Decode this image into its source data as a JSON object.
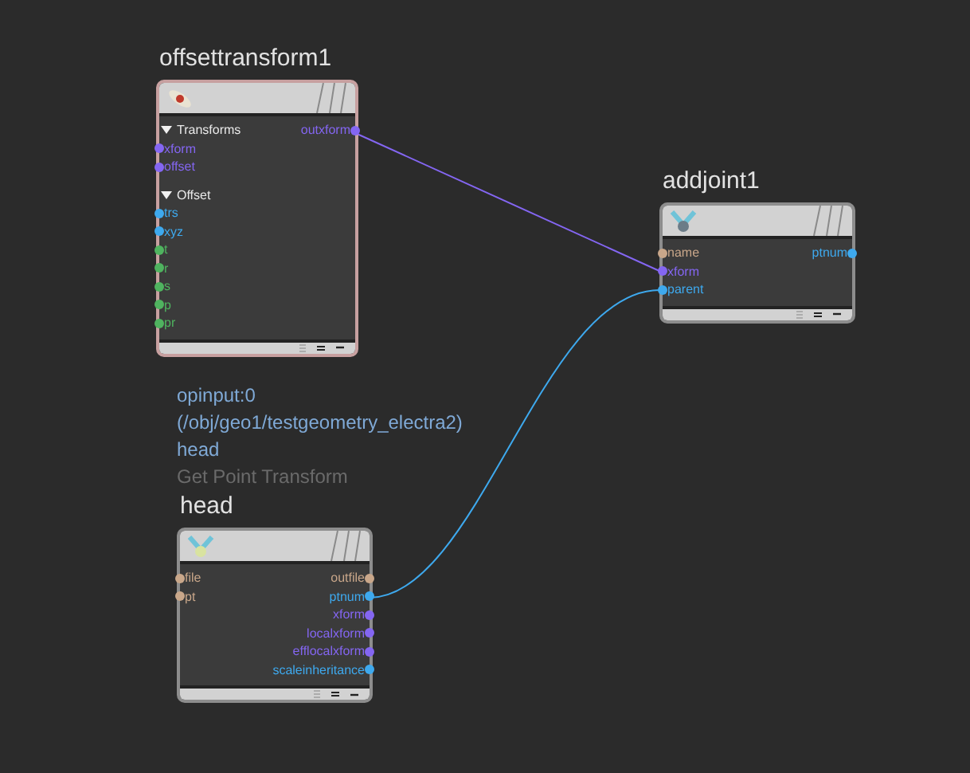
{
  "nodes": [
    {
      "name": "offsettransform1",
      "selected": true,
      "inputs": [
        {
          "kind": "group",
          "label": "Transforms",
          "expanded": true
        },
        {
          "kind": "port",
          "label": "xform",
          "color": "#8466f2"
        },
        {
          "kind": "port",
          "label": "offset",
          "color": "#8466f2"
        },
        {
          "kind": "group",
          "label": "Offset",
          "expanded": true
        },
        {
          "kind": "port",
          "label": "trs",
          "color": "#3ea9ee"
        },
        {
          "kind": "port",
          "label": "xyz",
          "color": "#3ea9ee"
        },
        {
          "kind": "port",
          "label": "t",
          "color": "#4fb35f"
        },
        {
          "kind": "port",
          "label": "r",
          "color": "#4fb35f"
        },
        {
          "kind": "port",
          "label": "s",
          "color": "#4fb35f"
        },
        {
          "kind": "port",
          "label": "p",
          "color": "#4fb35f"
        },
        {
          "kind": "port",
          "label": "pr",
          "color": "#4fb35f"
        }
      ],
      "outputs": [
        {
          "kind": "port",
          "label": "outxform",
          "color": "#8466f2"
        }
      ]
    },
    {
      "name": "addjoint1",
      "selected": false,
      "inputs": [
        {
          "kind": "port",
          "label": "name",
          "color": "#c9a78a"
        },
        {
          "kind": "port",
          "label": "xform",
          "color": "#8466f2"
        },
        {
          "kind": "port",
          "label": "parent",
          "color": "#3ea9ee"
        }
      ],
      "outputs": [
        {
          "kind": "port",
          "label": "ptnum",
          "color": "#3ea9ee"
        }
      ]
    },
    {
      "name": "head",
      "selected": false,
      "info": [
        {
          "kind": "link",
          "text": "opinput:0"
        },
        {
          "kind": "link",
          "text": "(/obj/geo1/testgeometry_electra2)"
        },
        {
          "kind": "link",
          "text": "head"
        },
        {
          "kind": "type",
          "text": "Get Point Transform"
        }
      ],
      "inputs": [
        {
          "kind": "port",
          "label": "file",
          "color": "#c9a78a"
        },
        {
          "kind": "port",
          "label": "pt",
          "color": "#c9a78a"
        }
      ],
      "outputs": [
        {
          "kind": "port",
          "label": "outfile",
          "color": "#c9a78a"
        },
        {
          "kind": "port",
          "label": "ptnum",
          "color": "#3ea9ee"
        },
        {
          "kind": "port",
          "label": "xform",
          "color": "#8466f2"
        },
        {
          "kind": "port",
          "label": "localxform",
          "color": "#8466f2"
        },
        {
          "kind": "port",
          "label": "efflocalxform",
          "color": "#8466f2"
        },
        {
          "kind": "port",
          "label": "scaleinheritance",
          "color": "#3ea9ee"
        }
      ]
    }
  ],
  "connections": [
    {
      "color": "#8466f2"
    },
    {
      "color": "#3ea9ee"
    }
  ]
}
